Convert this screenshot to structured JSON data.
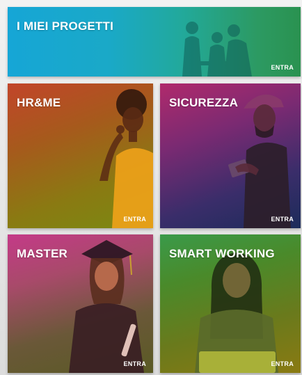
{
  "tiles": {
    "projects": {
      "title": "I MIEI PROGETTI",
      "cta": "ENTRA"
    },
    "hr": {
      "title": "HR&ME",
      "cta": "ENTRA"
    },
    "sicurezza": {
      "title": "SICUREZZA",
      "cta": "ENTRA"
    },
    "master": {
      "title": "MASTER",
      "cta": "ENTRA"
    },
    "smart": {
      "title": "SMART WORKING",
      "cta": "ENTRA"
    }
  },
  "colors": {
    "projects_accent": "#1aa9c7",
    "hr_accent": "#a65a1c",
    "sicurezza_accent": "#7a2a72",
    "master_accent": "#c43a88",
    "smart_accent": "#4a8a2a"
  },
  "images": {
    "projects": "team-meeting-photo",
    "hr": "woman-surprised-photo",
    "sicurezza": "worker-with-helmet-photo",
    "master": "graduate-photo",
    "smart": "woman-with-laptop-photo"
  }
}
